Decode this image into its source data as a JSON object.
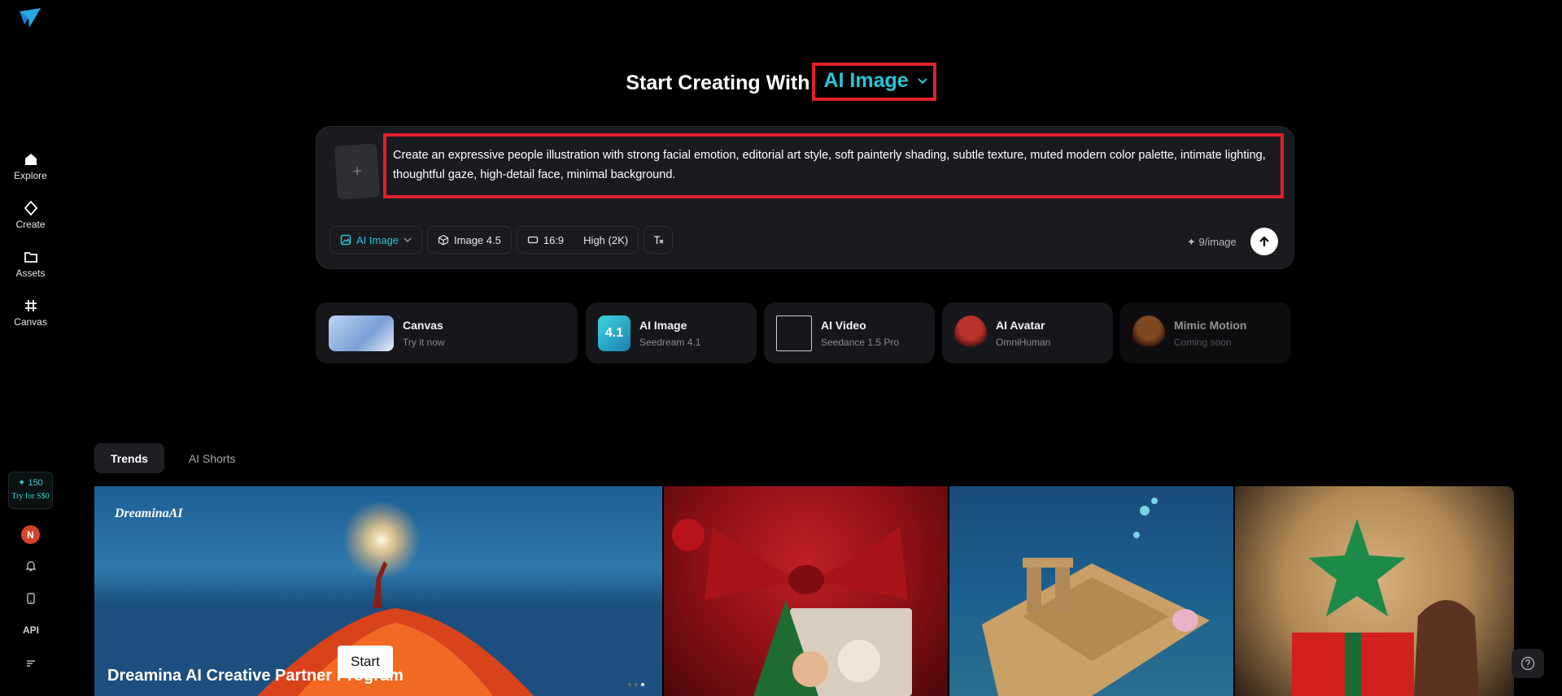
{
  "sidebar": {
    "nav": [
      {
        "label": "Explore",
        "icon": "home-icon"
      },
      {
        "label": "Create",
        "icon": "diamond-icon"
      },
      {
        "label": "Assets",
        "icon": "folder-icon"
      },
      {
        "label": "Canvas",
        "icon": "canvas-icon"
      }
    ],
    "credits": {
      "amount": "✦ 150",
      "cta": "Try for S$0"
    },
    "avatar_initial": "N",
    "api_label": "API"
  },
  "heading": {
    "prefix": "Start Creating With",
    "mode": "AI Image"
  },
  "prompt": {
    "text": "Create an expressive people illustration with strong facial emotion, editorial art style, soft painterly shading, subtle texture, muted modern color palette, intimate lighting, thoughtful gaze, high-detail face, minimal background.",
    "upload_glyph": "+",
    "tools": {
      "mode": "AI Image",
      "model": "Image 4.5",
      "ratio": "16:9",
      "quality": "High (2K)"
    },
    "cost": "✦ 9/image"
  },
  "features": [
    {
      "title": "Canvas",
      "subtitle": "Try it now"
    },
    {
      "title": "AI Image",
      "subtitle": "Seedream 4.1",
      "badge": "4.1"
    },
    {
      "title": "AI Video",
      "subtitle": "Seedance 1.5 Pro"
    },
    {
      "title": "AI Avatar",
      "subtitle": "OmniHuman"
    },
    {
      "title": "Mimic Motion",
      "subtitle": "Coming soon"
    }
  ],
  "tabs": [
    "Trends",
    "AI Shorts"
  ],
  "banner": {
    "logo": "DreaminaAI",
    "title": "Dreamina AI Creative Partner Program",
    "start": "Start"
  },
  "colors": {
    "accent": "#27c6d9",
    "highlight": "#e2202a",
    "avatar": "#d2442a"
  }
}
